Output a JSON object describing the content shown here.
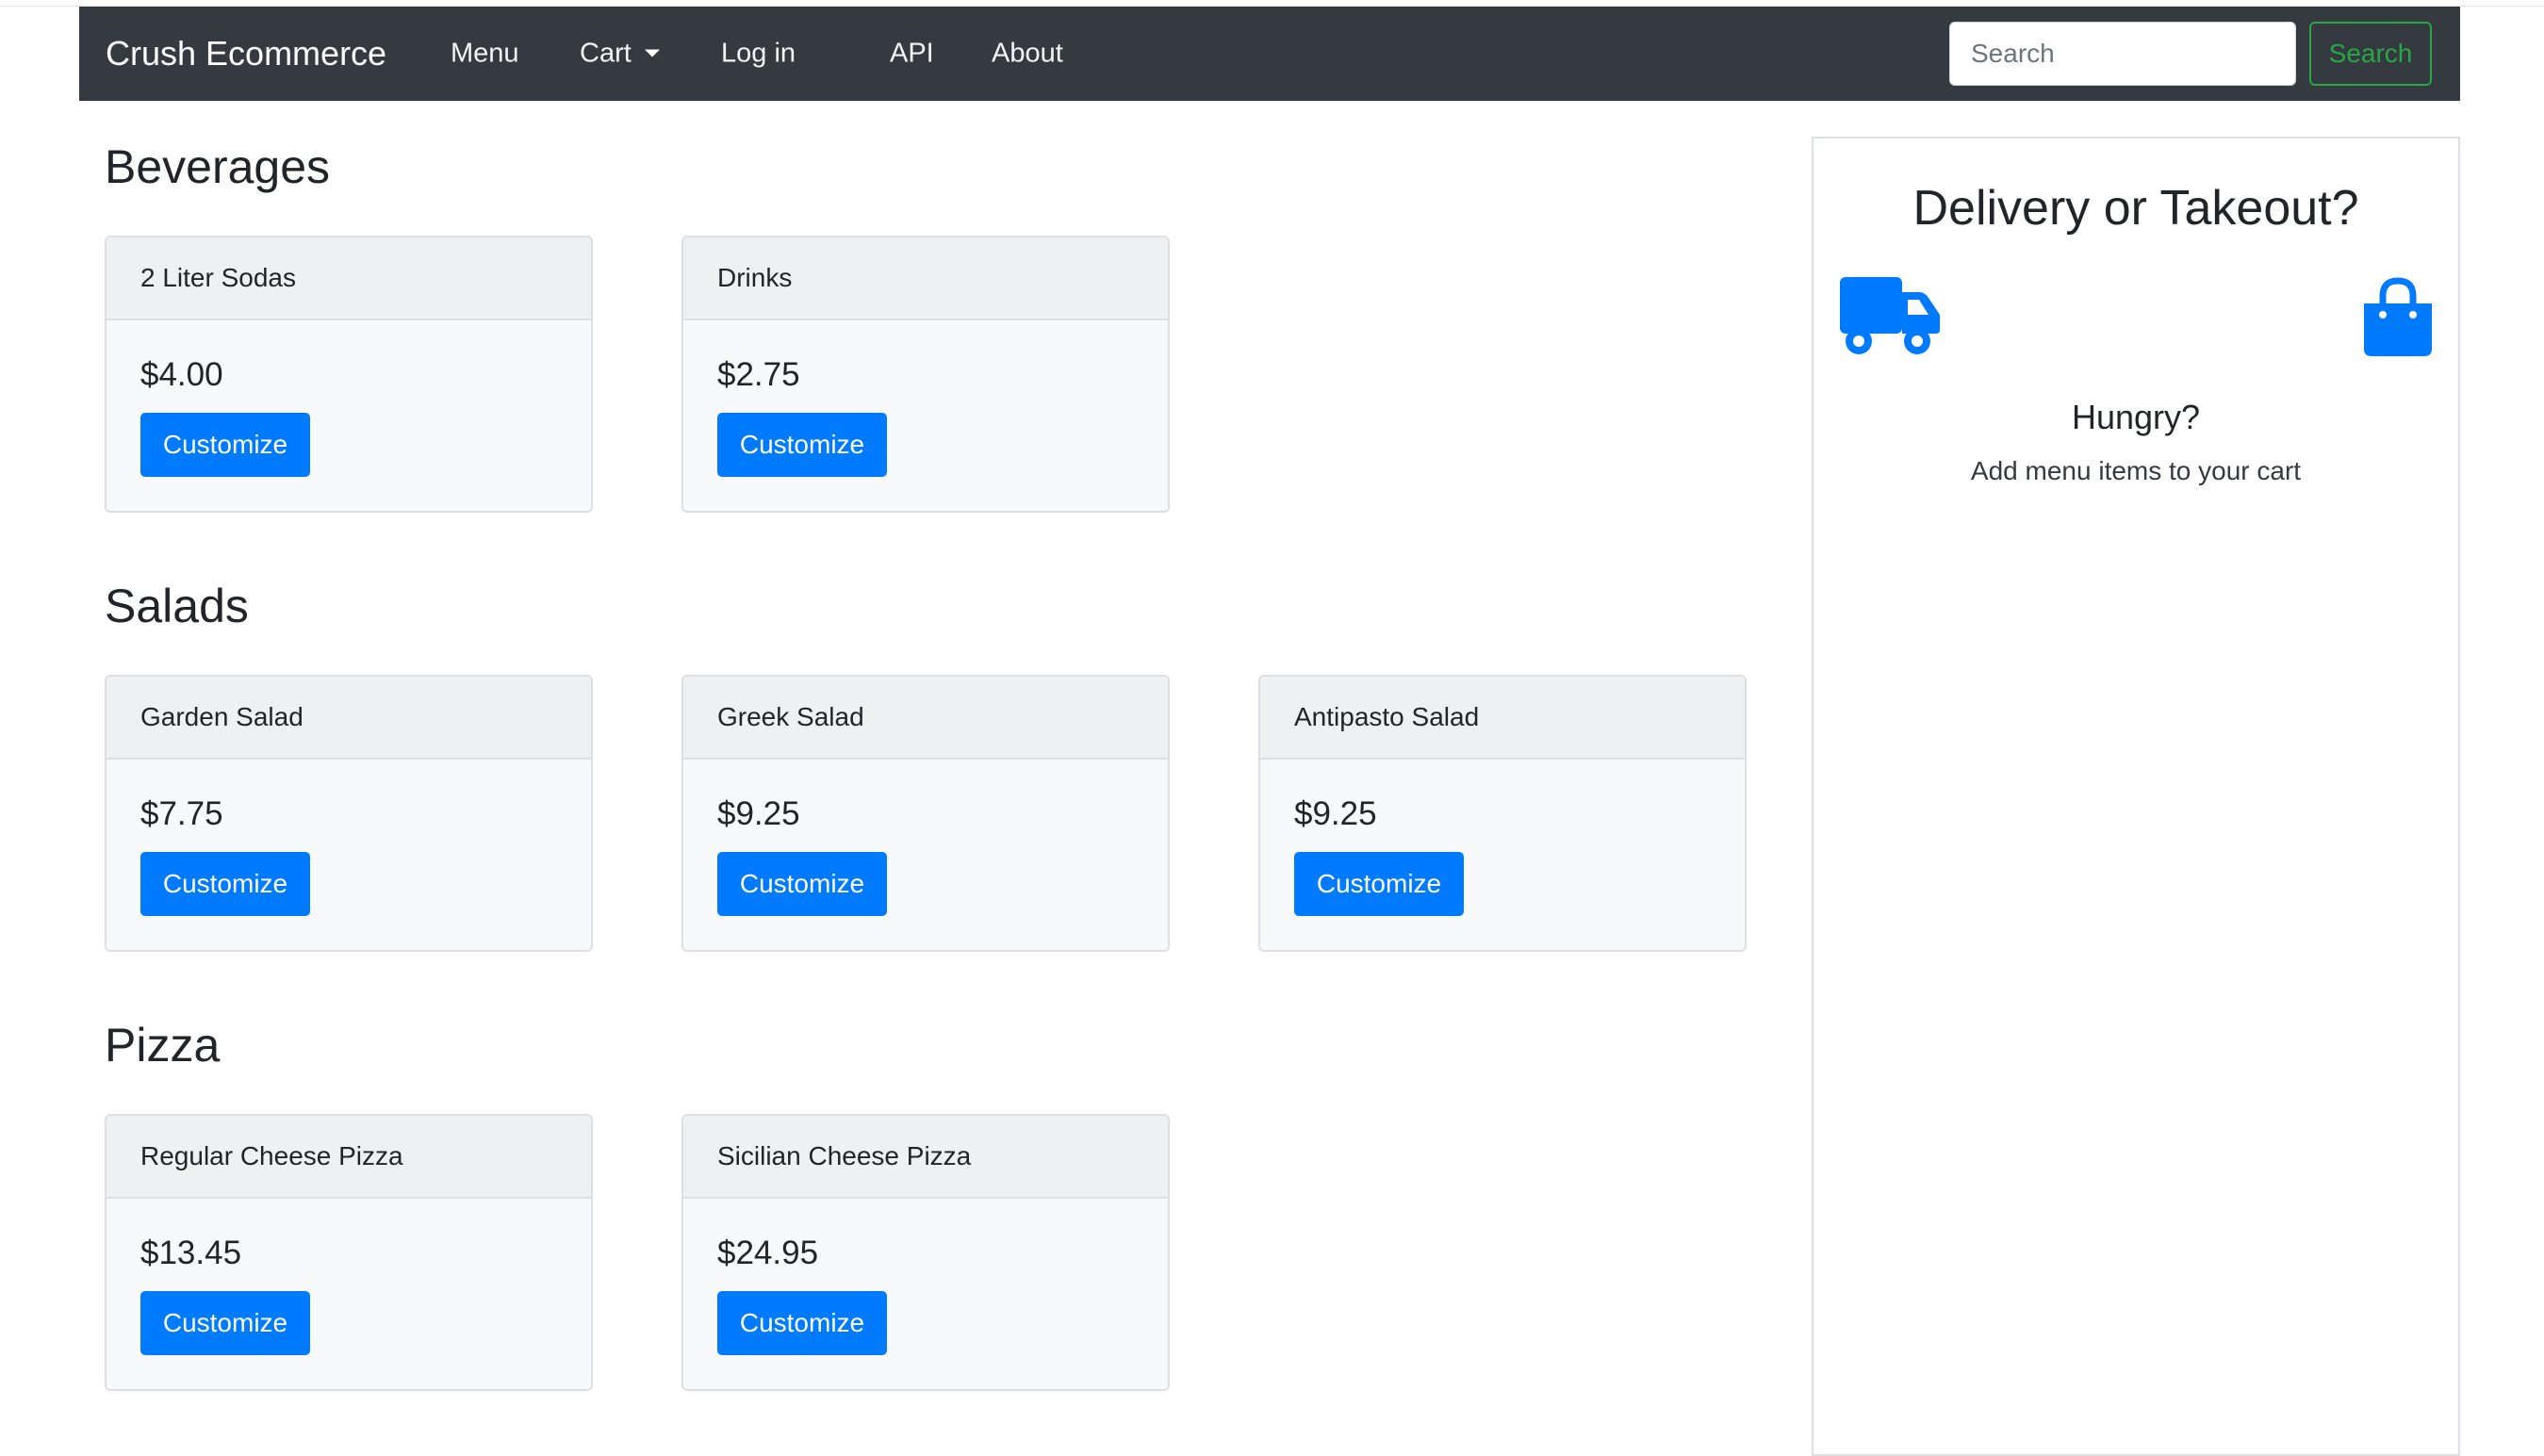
{
  "navbar": {
    "brand": "Crush Ecommerce",
    "links": {
      "menu": "Menu",
      "cart": "Cart",
      "login": "Log in",
      "api": "API",
      "about": "About"
    },
    "search": {
      "placeholder": "Search",
      "button_label": "Search"
    }
  },
  "sections": [
    {
      "title": "Beverages",
      "items": [
        {
          "name": "2 Liter Sodas",
          "price": "$4.00",
          "button": "Customize"
        },
        {
          "name": "Drinks",
          "price": "$2.75",
          "button": "Customize"
        }
      ]
    },
    {
      "title": "Salads",
      "items": [
        {
          "name": "Garden Salad",
          "price": "$7.75",
          "button": "Customize"
        },
        {
          "name": "Greek Salad",
          "price": "$9.25",
          "button": "Customize"
        },
        {
          "name": "Antipasto Salad",
          "price": "$9.25",
          "button": "Customize"
        }
      ]
    },
    {
      "title": "Pizza",
      "items": [
        {
          "name": "Regular Cheese Pizza",
          "price": "$13.45",
          "button": "Customize"
        },
        {
          "name": "Sicilian Cheese Pizza",
          "price": "$24.95",
          "button": "Customize"
        }
      ]
    }
  ],
  "sidebar": {
    "title": "Delivery or Takeout?",
    "delivery_icon": "truck-icon",
    "takeout_icon": "shopping-bag-icon",
    "empty_heading": "Hungry?",
    "empty_text": "Add menu items to your cart"
  },
  "colors": {
    "navbar_bg": "#343a40",
    "primary": "#007bff",
    "success": "#28a745"
  }
}
